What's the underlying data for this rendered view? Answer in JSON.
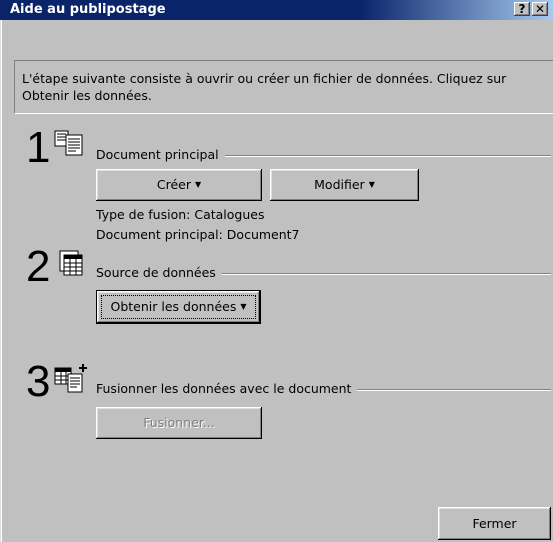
{
  "window": {
    "title": "Aide au publipostage",
    "help_label": "?",
    "close_label": "✕"
  },
  "info": {
    "text": "L'étape suivante consiste à ouvrir ou créer un fichier de données. Cliquez sur Obtenir les données."
  },
  "step1": {
    "number": "1",
    "icon": "main-document-icon",
    "label": "Document principal",
    "create_label": "Créer",
    "modify_label": "Modifier",
    "merge_type": "Type de fusion: Catalogues",
    "main_document": "Document principal: Document7"
  },
  "step2": {
    "number": "2",
    "icon": "data-source-icon",
    "label": "Source de données",
    "get_data_label": "Obtenir les données"
  },
  "step3": {
    "number": "3",
    "icon": "merge-icon",
    "label": "Fusionner les données avec le document",
    "merge_label": "Fusionner..."
  },
  "footer": {
    "close_label": "Fermer"
  }
}
